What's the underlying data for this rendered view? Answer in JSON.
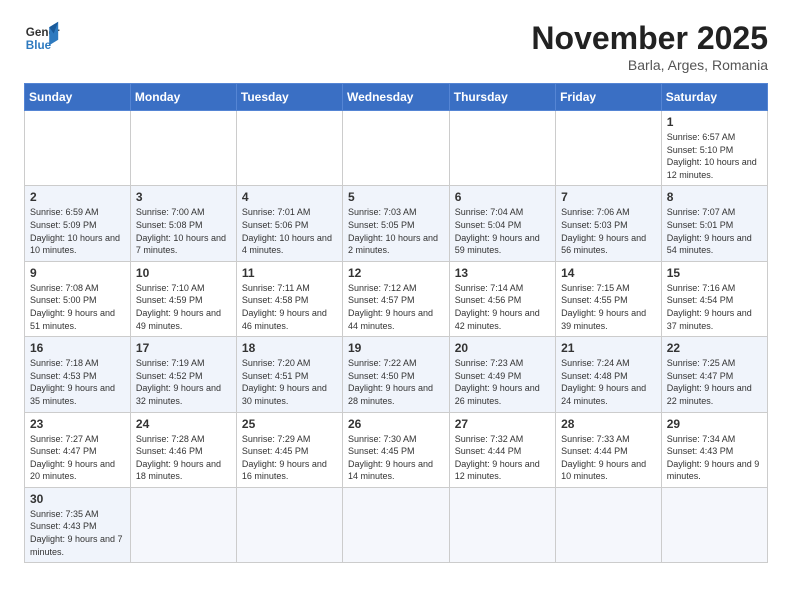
{
  "header": {
    "logo_general": "General",
    "logo_blue": "Blue",
    "month_title": "November 2025",
    "location": "Barla, Arges, Romania"
  },
  "days_of_week": [
    "Sunday",
    "Monday",
    "Tuesday",
    "Wednesday",
    "Thursday",
    "Friday",
    "Saturday"
  ],
  "weeks": [
    [
      {
        "day": "",
        "info": ""
      },
      {
        "day": "",
        "info": ""
      },
      {
        "day": "",
        "info": ""
      },
      {
        "day": "",
        "info": ""
      },
      {
        "day": "",
        "info": ""
      },
      {
        "day": "",
        "info": ""
      },
      {
        "day": "1",
        "info": "Sunrise: 6:57 AM\nSunset: 5:10 PM\nDaylight: 10 hours and 12 minutes."
      }
    ],
    [
      {
        "day": "2",
        "info": "Sunrise: 6:59 AM\nSunset: 5:09 PM\nDaylight: 10 hours and 10 minutes."
      },
      {
        "day": "3",
        "info": "Sunrise: 7:00 AM\nSunset: 5:08 PM\nDaylight: 10 hours and 7 minutes."
      },
      {
        "day": "4",
        "info": "Sunrise: 7:01 AM\nSunset: 5:06 PM\nDaylight: 10 hours and 4 minutes."
      },
      {
        "day": "5",
        "info": "Sunrise: 7:03 AM\nSunset: 5:05 PM\nDaylight: 10 hours and 2 minutes."
      },
      {
        "day": "6",
        "info": "Sunrise: 7:04 AM\nSunset: 5:04 PM\nDaylight: 9 hours and 59 minutes."
      },
      {
        "day": "7",
        "info": "Sunrise: 7:06 AM\nSunset: 5:03 PM\nDaylight: 9 hours and 56 minutes."
      },
      {
        "day": "8",
        "info": "Sunrise: 7:07 AM\nSunset: 5:01 PM\nDaylight: 9 hours and 54 minutes."
      }
    ],
    [
      {
        "day": "9",
        "info": "Sunrise: 7:08 AM\nSunset: 5:00 PM\nDaylight: 9 hours and 51 minutes."
      },
      {
        "day": "10",
        "info": "Sunrise: 7:10 AM\nSunset: 4:59 PM\nDaylight: 9 hours and 49 minutes."
      },
      {
        "day": "11",
        "info": "Sunrise: 7:11 AM\nSunset: 4:58 PM\nDaylight: 9 hours and 46 minutes."
      },
      {
        "day": "12",
        "info": "Sunrise: 7:12 AM\nSunset: 4:57 PM\nDaylight: 9 hours and 44 minutes."
      },
      {
        "day": "13",
        "info": "Sunrise: 7:14 AM\nSunset: 4:56 PM\nDaylight: 9 hours and 42 minutes."
      },
      {
        "day": "14",
        "info": "Sunrise: 7:15 AM\nSunset: 4:55 PM\nDaylight: 9 hours and 39 minutes."
      },
      {
        "day": "15",
        "info": "Sunrise: 7:16 AM\nSunset: 4:54 PM\nDaylight: 9 hours and 37 minutes."
      }
    ],
    [
      {
        "day": "16",
        "info": "Sunrise: 7:18 AM\nSunset: 4:53 PM\nDaylight: 9 hours and 35 minutes."
      },
      {
        "day": "17",
        "info": "Sunrise: 7:19 AM\nSunset: 4:52 PM\nDaylight: 9 hours and 32 minutes."
      },
      {
        "day": "18",
        "info": "Sunrise: 7:20 AM\nSunset: 4:51 PM\nDaylight: 9 hours and 30 minutes."
      },
      {
        "day": "19",
        "info": "Sunrise: 7:22 AM\nSunset: 4:50 PM\nDaylight: 9 hours and 28 minutes."
      },
      {
        "day": "20",
        "info": "Sunrise: 7:23 AM\nSunset: 4:49 PM\nDaylight: 9 hours and 26 minutes."
      },
      {
        "day": "21",
        "info": "Sunrise: 7:24 AM\nSunset: 4:48 PM\nDaylight: 9 hours and 24 minutes."
      },
      {
        "day": "22",
        "info": "Sunrise: 7:25 AM\nSunset: 4:47 PM\nDaylight: 9 hours and 22 minutes."
      }
    ],
    [
      {
        "day": "23",
        "info": "Sunrise: 7:27 AM\nSunset: 4:47 PM\nDaylight: 9 hours and 20 minutes."
      },
      {
        "day": "24",
        "info": "Sunrise: 7:28 AM\nSunset: 4:46 PM\nDaylight: 9 hours and 18 minutes."
      },
      {
        "day": "25",
        "info": "Sunrise: 7:29 AM\nSunset: 4:45 PM\nDaylight: 9 hours and 16 minutes."
      },
      {
        "day": "26",
        "info": "Sunrise: 7:30 AM\nSunset: 4:45 PM\nDaylight: 9 hours and 14 minutes."
      },
      {
        "day": "27",
        "info": "Sunrise: 7:32 AM\nSunset: 4:44 PM\nDaylight: 9 hours and 12 minutes."
      },
      {
        "day": "28",
        "info": "Sunrise: 7:33 AM\nSunset: 4:44 PM\nDaylight: 9 hours and 10 minutes."
      },
      {
        "day": "29",
        "info": "Sunrise: 7:34 AM\nSunset: 4:43 PM\nDaylight: 9 hours and 9 minutes."
      }
    ],
    [
      {
        "day": "30",
        "info": "Sunrise: 7:35 AM\nSunset: 4:43 PM\nDaylight: 9 hours and 7 minutes."
      },
      {
        "day": "",
        "info": ""
      },
      {
        "day": "",
        "info": ""
      },
      {
        "day": "",
        "info": ""
      },
      {
        "day": "",
        "info": ""
      },
      {
        "day": "",
        "info": ""
      },
      {
        "day": "",
        "info": ""
      }
    ]
  ]
}
